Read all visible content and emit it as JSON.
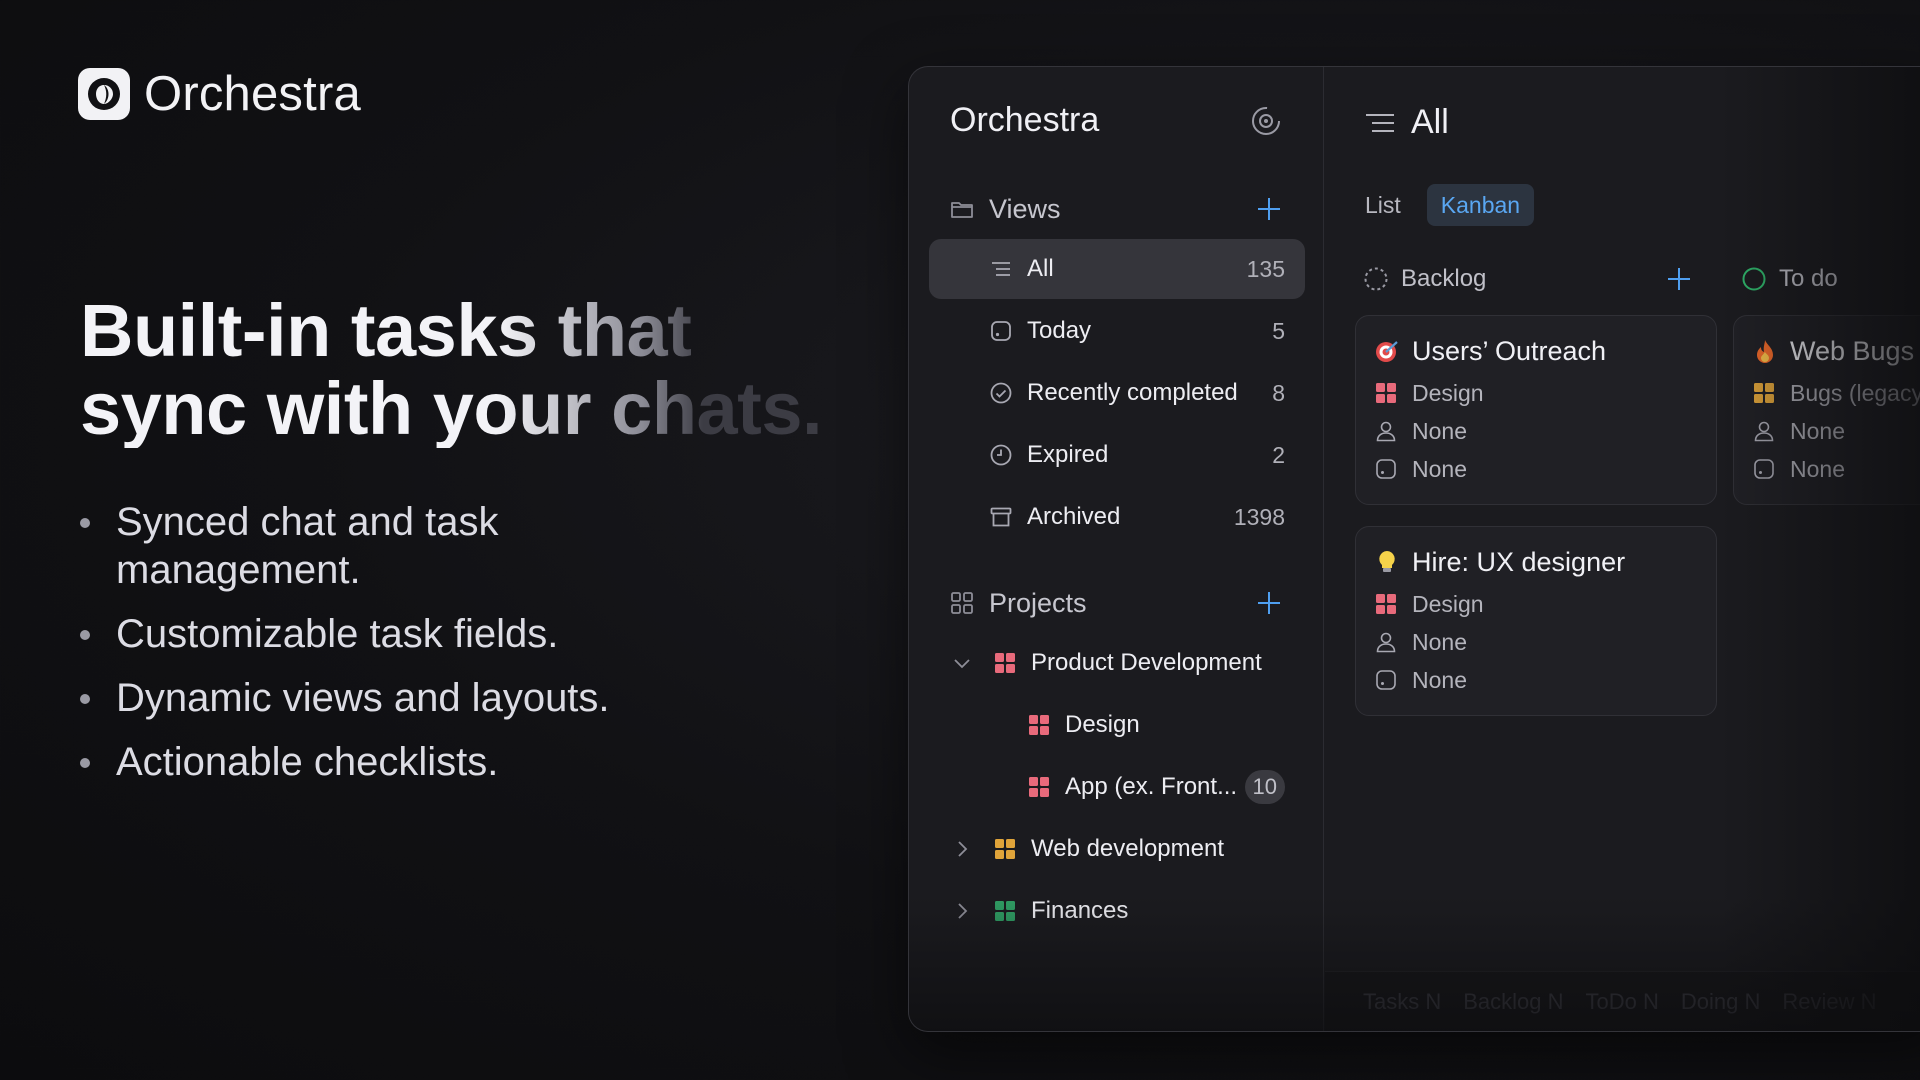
{
  "brand": {
    "name": "Orchestra"
  },
  "hero": {
    "headline_line1": "Built-in tasks that",
    "headline_line2": "sync with your chats.",
    "bullets": [
      "Synced chat and task management.",
      "Customizable task fields.",
      "Dynamic views and layouts.",
      "Actionable checklists."
    ]
  },
  "app": {
    "sidebar": {
      "title": "Orchestra",
      "views": {
        "label": "Views",
        "items": [
          {
            "label": "All",
            "count": "135",
            "icon": "list-icon",
            "active": true
          },
          {
            "label": "Today",
            "count": "5",
            "icon": "calendar-today-icon"
          },
          {
            "label": "Recently completed",
            "count": "8",
            "icon": "check-circle-icon"
          },
          {
            "label": "Expired",
            "count": "2",
            "icon": "clock-icon"
          },
          {
            "label": "Archived",
            "count": "1398",
            "icon": "archive-icon"
          }
        ]
      },
      "projects": {
        "label": "Projects",
        "items": [
          {
            "label": "Product Development",
            "expanded": true,
            "color": "#e86a7b"
          },
          {
            "label": "Design",
            "color": "#e86a7b"
          },
          {
            "label": "App (ex. Front...",
            "badge": "10",
            "color": "#e86a7b"
          },
          {
            "label": "Web development",
            "expanded": false,
            "color": "#e0a43a"
          },
          {
            "label": "Finances",
            "expanded": false,
            "color": "#2f9c63"
          }
        ]
      }
    },
    "main": {
      "title": "All",
      "tabs": [
        {
          "label": "List",
          "active": false
        },
        {
          "label": "Kanban",
          "active": true
        }
      ],
      "columns": [
        {
          "label": "Backlog",
          "cards": [
            {
              "emoji": "target-icon",
              "title": "Users’ Outreach",
              "project": "Design",
              "assignee": "None",
              "date": "None"
            },
            {
              "emoji": "lightbulb-icon",
              "title": "Hire: UX designer",
              "project": "Design",
              "assignee": "None",
              "date": "None"
            }
          ]
        },
        {
          "label": "To do",
          "cards": [
            {
              "emoji": "fire-icon",
              "title": "Web Bugs",
              "project": "Bugs (legacy)",
              "assignee": "None",
              "date": "None"
            }
          ]
        }
      ],
      "statusbar": [
        "Tasks N",
        "Backlog N",
        "ToDo N",
        "Doing N",
        "Review N"
      ]
    },
    "colors": {
      "accent": "#5aa7f2",
      "design": "#e86a7b",
      "web": "#e0a43a",
      "finance": "#2f9c63"
    }
  }
}
